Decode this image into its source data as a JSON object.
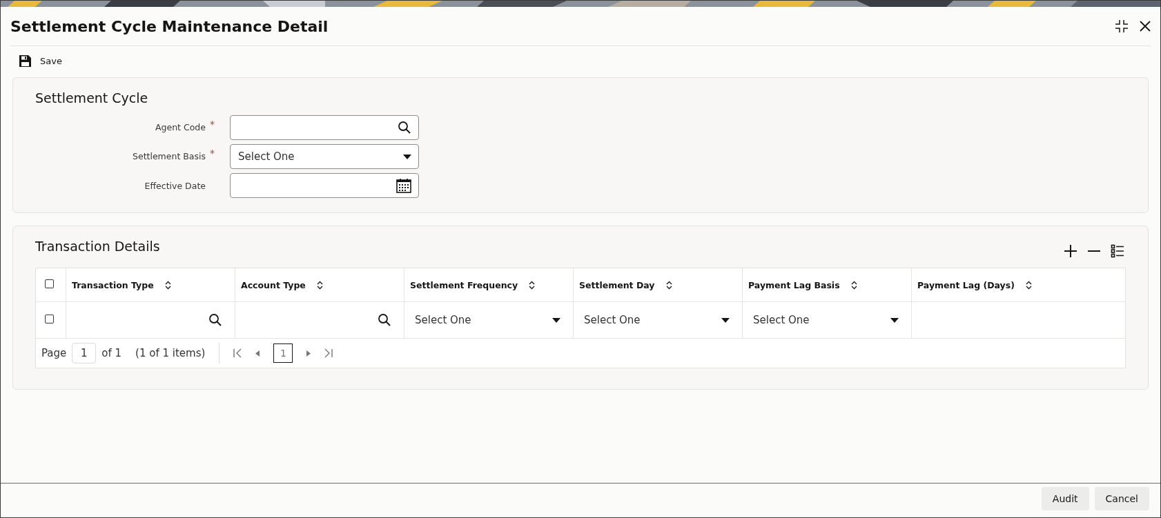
{
  "window": {
    "title": "Settlement Cycle Maintenance Detail"
  },
  "toolbar": [
    {
      "label": "Save"
    }
  ],
  "settlement_cycle": {
    "title": "Settlement Cycle",
    "fields": [
      {
        "kind": "lookup",
        "label": "Agent Code",
        "required_mark": "*"
      },
      {
        "kind": "select",
        "label": "Settlement Basis",
        "required_mark": "*",
        "value": "Select One"
      },
      {
        "kind": "date",
        "label": "Effective Date"
      }
    ]
  },
  "transaction_details": {
    "title": "Transaction Details",
    "header_checked": false,
    "columns": [
      "Transaction Type",
      "Account Type",
      "Settlement Frequency",
      "Settlement Day",
      "Payment Lag Basis",
      "Payment Lag (Days)"
    ],
    "rows": [
      {
        "checked": false,
        "cells": [
          {
            "kind": "lookup"
          },
          {
            "kind": "lookup"
          },
          {
            "kind": "select",
            "value": "Select One"
          },
          {
            "kind": "select",
            "value": "Select One"
          },
          {
            "kind": "select",
            "value": "Select One"
          },
          {
            "kind": "text"
          }
        ]
      }
    ],
    "pagination": {
      "page_label": "Page",
      "page": "1",
      "of": "of 1",
      "items": "(1 of 1 items)",
      "current": "1"
    }
  },
  "buttons": [
    "Audit",
    "Cancel"
  ]
}
